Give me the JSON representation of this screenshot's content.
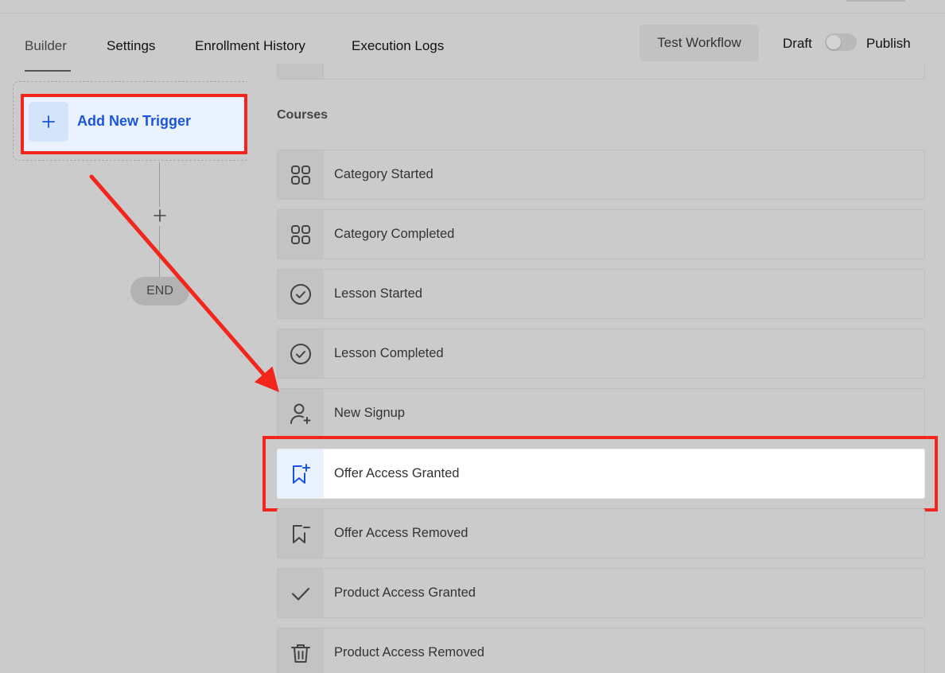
{
  "header": {
    "tabs": [
      {
        "label": "Builder",
        "active": true
      },
      {
        "label": "Settings",
        "active": false
      },
      {
        "label": "Enrollment History",
        "active": false
      },
      {
        "label": "Execution Logs",
        "active": false
      }
    ],
    "test_button": "Test Workflow",
    "draft_label": "Draft",
    "publish_label": "Publish",
    "toggle_on": false
  },
  "canvas": {
    "trigger_label": "Add New Trigger",
    "trigger_icon": "plus-icon",
    "add_step_icon": "plus-icon",
    "end_label": "END"
  },
  "panel": {
    "section_title": "Courses",
    "items": [
      {
        "label": "Category Started",
        "icon": "grid-icon"
      },
      {
        "label": "Category Completed",
        "icon": "grid-icon"
      },
      {
        "label": "Lesson Started",
        "icon": "check-circle-icon"
      },
      {
        "label": "Lesson Completed",
        "icon": "check-circle-icon"
      },
      {
        "label": "New Signup",
        "icon": "user-plus-icon"
      },
      {
        "label": "Offer Access Granted",
        "icon": "bookmark-plus-icon",
        "selected": true
      },
      {
        "label": "Offer Access Removed",
        "icon": "bookmark-minus-icon"
      },
      {
        "label": "Product Access Granted",
        "icon": "check-icon"
      },
      {
        "label": "Product Access Removed",
        "icon": "trash-icon"
      }
    ]
  },
  "colors": {
    "accent_blue": "#1a56db",
    "annotation_red": "#f2261c",
    "overlay_gray": "#cbcbcb"
  }
}
